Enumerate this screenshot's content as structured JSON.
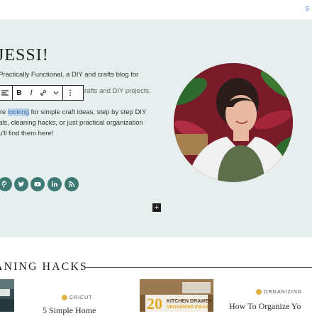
{
  "topbar": {
    "corner_text": "S"
  },
  "hero": {
    "title": "JESSI!",
    "paragraph1_lines": [
      "Practically Functional, a DIY and crafts blog for",
      "believe that anyone can do crafts and DIY projects,"
    ],
    "paragraph2": {
      "line1_before": "'re ",
      "line1_highlight": "looking",
      "line1_after": " for simple craft ideas, step by step DIY",
      "line2": "als, cleaning hacks, or just practical organization",
      "line3": "u'll find them here!"
    },
    "social_icons": [
      "pinterest-icon",
      "twitter-icon",
      "youtube-icon",
      "linkedin-icon",
      "rss-icon"
    ],
    "accent_color": "#3e7a74",
    "background_color": "#e6eeee"
  },
  "block_toolbar": {
    "buttons": [
      "align-icon",
      "bold-button",
      "italic-button",
      "link-button",
      "more-options-chevron",
      "options-menu"
    ],
    "bold_label": "B",
    "italic_label": "I"
  },
  "add_block_label": "+",
  "section": {
    "heading": "ANING HACKS",
    "cards": [
      {
        "category": "CRICUT",
        "title": "5 Simple Home"
      },
      {
        "image_caption_number": "20",
        "image_caption_line1": "KITCHEN DRAWER",
        "image_caption_line2": "ORGANIZING IDEAS"
      },
      {
        "category": "ORGANIZING",
        "title": "How To Organize Yo"
      }
    ]
  }
}
